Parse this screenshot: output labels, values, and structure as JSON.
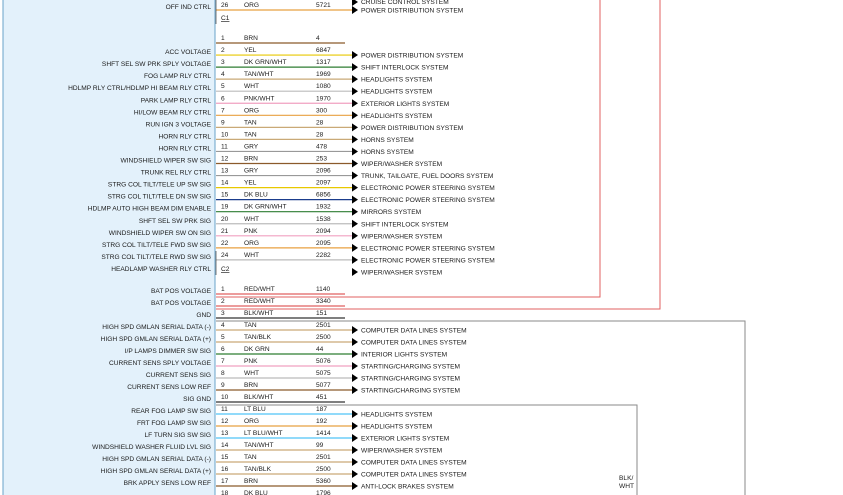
{
  "colors": {
    "module_fill": "#e3f1fb",
    "module_edge": "#6aa3c8",
    "red_line": "#e06060",
    "gray_line": "#8a8a8a",
    "arrow": "#000000"
  },
  "top_rows": [
    {
      "label": "OFF IND CTRL",
      "pin": "26",
      "color": "ORG",
      "circuit": "5721",
      "system": "POWER DISTRIBUTION SYSTEM",
      "wire": "#e8a040"
    }
  ],
  "top_prev_system": "CRUISE CONTROL SYSTEM",
  "connectors": [
    {
      "id": "C1-block",
      "label": "C1",
      "rows": [
        {
          "label": "",
          "pin": "1",
          "color": "BRN",
          "circuit": "4",
          "system": "",
          "wire": "#8b5a2b"
        },
        {
          "label": "ACC VOLTAGE",
          "pin": "2",
          "color": "YEL",
          "circuit": "6847",
          "system": "POWER DISTRIBUTION SYSTEM",
          "wire": "#e8c800"
        },
        {
          "label": "SHFT SEL SW PRK SPLY VOLTAGE",
          "pin": "3",
          "color": "DK GRN/WHT",
          "circuit": "1317",
          "system": "SHIFT INTERLOCK SYSTEM",
          "wire": "#2e7d32"
        },
        {
          "label": "FOG LAMP RLY CTRL",
          "pin": "4",
          "color": "TAN/WHT",
          "circuit": "1969",
          "system": "HEADLIGHTS SYSTEM",
          "wire": "#c9a977"
        },
        {
          "label": "HDLMP RLY CTRL/HDLMP HI BEAM RLY CTRL",
          "pin": "5",
          "color": "WHT",
          "circuit": "1080",
          "system": "HEADLIGHTS SYSTEM",
          "wire": "#bbbbbb"
        },
        {
          "label": "PARK LAMP RLY CTRL",
          "pin": "6",
          "color": "PNK/WHT",
          "circuit": "1970",
          "system": "EXTERIOR LIGHTS SYSTEM",
          "wire": "#f0a0c0"
        },
        {
          "label": "HI/LOW BEAM RLY CTRL",
          "pin": "7",
          "color": "ORG",
          "circuit": "300",
          "system": "HEADLIGHTS SYSTEM",
          "wire": "#e8a040"
        },
        {
          "label": "RUN IGN 3 VOLTAGE",
          "pin": "9",
          "color": "TAN",
          "circuit": "28",
          "system": "POWER DISTRIBUTION SYSTEM",
          "wire": "#c9a977"
        },
        {
          "label": "HORN RLY CTRL",
          "pin": "10",
          "color": "TAN",
          "circuit": "28",
          "system": "HORNS SYSTEM",
          "wire": "#c9a977"
        },
        {
          "label": "HORN RLY CTRL",
          "pin": "11",
          "color": "GRY",
          "circuit": "478",
          "system": "HORNS SYSTEM",
          "wire": "#999999"
        },
        {
          "label": "WINDSHIELD WIPER SW SIG",
          "pin": "12",
          "color": "BRN",
          "circuit": "253",
          "system": "WIPER/WASHER SYSTEM",
          "wire": "#8b5a2b"
        },
        {
          "label": "TRUNK REL RLY CTRL",
          "pin": "13",
          "color": "GRY",
          "circuit": "2096",
          "system": "TRUNK, TAILGATE, FUEL DOORS SYSTEM",
          "wire": "#999999"
        },
        {
          "label": "STRG COL TILT/TELE UP SW SIG",
          "pin": "14",
          "color": "YEL",
          "circuit": "2097",
          "system": "ELECTRONIC POWER STEERING SYSTEM",
          "wire": "#e8c800"
        },
        {
          "label": "STRG COL TILT/TELE DN SW SIG",
          "pin": "15",
          "color": "DK BLU",
          "circuit": "6856",
          "system": "ELECTRONIC POWER STEERING SYSTEM",
          "wire": "#1a3c8c"
        },
        {
          "label": "HDLMP AUTO HIGH BEAM DIM ENABLE",
          "pin": "19",
          "color": "DK GRN/WHT",
          "circuit": "1932",
          "system": "MIRRORS SYSTEM",
          "wire": "#2e7d32"
        },
        {
          "label": "SHFT SEL SW PRK SIG",
          "pin": "20",
          "color": "WHT",
          "circuit": "1538",
          "system": "SHIFT INTERLOCK SYSTEM",
          "wire": "#bbbbbb"
        },
        {
          "label": "WINDSHIELD WIPER SW ON SIG",
          "pin": "21",
          "color": "PNK",
          "circuit": "2094",
          "system": "WIPER/WASHER SYSTEM",
          "wire": "#f0a0c0"
        },
        {
          "label": "STRG COL TILT/TELE FWD SW SIG",
          "pin": "22",
          "color": "ORG",
          "circuit": "2095",
          "system": "ELECTRONIC POWER STEERING SYSTEM",
          "wire": "#e8a040"
        },
        {
          "label": "STRG COL TILT/TELE RWD SW SIG",
          "pin": "24",
          "color": "WHT",
          "circuit": "2282",
          "system": "ELECTRONIC POWER STEERING SYSTEM",
          "wire": "#bbbbbb"
        },
        {
          "label": "HEADLAMP WASHER RLY CTRL",
          "pin": "",
          "color": "",
          "circuit": "",
          "system": "WIPER/WASHER SYSTEM",
          "wire": ""
        }
      ]
    },
    {
      "id": "C2-block",
      "label": "C2",
      "rows": [
        {
          "label": "BAT POS VOLTAGE",
          "pin": "1",
          "color": "RED/WHT",
          "circuit": "1140",
          "system": "",
          "wire": "#e06060"
        },
        {
          "label": "BAT POS VOLTAGE",
          "pin": "2",
          "color": "RED/WHT",
          "circuit": "3340",
          "system": "",
          "wire": "#e06060"
        },
        {
          "label": "GND",
          "pin": "3",
          "color": "BLK/WHT",
          "circuit": "151",
          "system": "",
          "wire": "#333333"
        },
        {
          "label": "HIGH SPD GMLAN SERIAL DATA (-)",
          "pin": "4",
          "color": "TAN",
          "circuit": "2501",
          "system": "COMPUTER DATA LINES SYSTEM",
          "wire": "#c9a977"
        },
        {
          "label": "HIGH SPD GMLAN SERIAL DATA (+)",
          "pin": "5",
          "color": "TAN/BLK",
          "circuit": "2500",
          "system": "COMPUTER DATA LINES SYSTEM",
          "wire": "#c9a977"
        },
        {
          "label": "I/P LAMPS DIMMER SW SIG",
          "pin": "6",
          "color": "DK GRN",
          "circuit": "44",
          "system": "INTERIOR LIGHTS SYSTEM",
          "wire": "#2e7d32"
        },
        {
          "label": "CURRENT SENS SPLY VOLTAGE",
          "pin": "7",
          "color": "PNK",
          "circuit": "5076",
          "system": "STARTING/CHARGING SYSTEM",
          "wire": "#f0a0c0"
        },
        {
          "label": "CURRENT SENS SIG",
          "pin": "8",
          "color": "WHT",
          "circuit": "5075",
          "system": "STARTING/CHARGING SYSTEM",
          "wire": "#bbbbbb"
        },
        {
          "label": "CURRENT SENS LOW REF",
          "pin": "9",
          "color": "BRN",
          "circuit": "5077",
          "system": "STARTING/CHARGING SYSTEM",
          "wire": "#8b5a2b"
        },
        {
          "label": "SIG GND",
          "pin": "10",
          "color": "BLK/WHT",
          "circuit": "451",
          "system": "",
          "wire": "#333333"
        },
        {
          "label": "REAR FOG LAMP SW SIG",
          "pin": "11",
          "color": "LT BLU",
          "circuit": "187",
          "system": "HEADLIGHTS SYSTEM",
          "wire": "#4fc3f7"
        },
        {
          "label": "FRT FOG LAMP SW SIG",
          "pin": "12",
          "color": "ORG",
          "circuit": "192",
          "system": "HEADLIGHTS SYSTEM",
          "wire": "#e8a040"
        },
        {
          "label": "LF TURN SIG SW SIG",
          "pin": "13",
          "color": "LT BLU/WHT",
          "circuit": "1414",
          "system": "EXTERIOR LIGHTS SYSTEM",
          "wire": "#4fc3f7"
        },
        {
          "label": "WINDSHIELD WASHER FLUID LVL SIG",
          "pin": "14",
          "color": "TAN/WHT",
          "circuit": "99",
          "system": "WIPER/WASHER SYSTEM",
          "wire": "#c9a977"
        },
        {
          "label": "HIGH SPD GMLAN SERIAL DATA (-)",
          "pin": "15",
          "color": "TAN",
          "circuit": "2501",
          "system": "COMPUTER DATA LINES SYSTEM",
          "wire": "#c9a977"
        },
        {
          "label": "HIGH SPD GMLAN SERIAL DATA (+)",
          "pin": "16",
          "color": "TAN/BLK",
          "circuit": "2500",
          "system": "COMPUTER DATA LINES SYSTEM",
          "wire": "#c9a977"
        },
        {
          "label": "BRK APPLY SENS LOW REF",
          "pin": "17",
          "color": "BRN",
          "circuit": "5360",
          "system": "ANTI-LOCK BRAKES SYSTEM",
          "wire": "#8b5a2b"
        },
        {
          "label": "",
          "pin": "18",
          "color": "DK BLU",
          "circuit": "1796",
          "system": "",
          "wire": "#1a3c8c"
        }
      ]
    }
  ],
  "side_note": "BLK/\nWHT",
  "side_note_lines": [
    "BLK/",
    "WHT"
  ]
}
